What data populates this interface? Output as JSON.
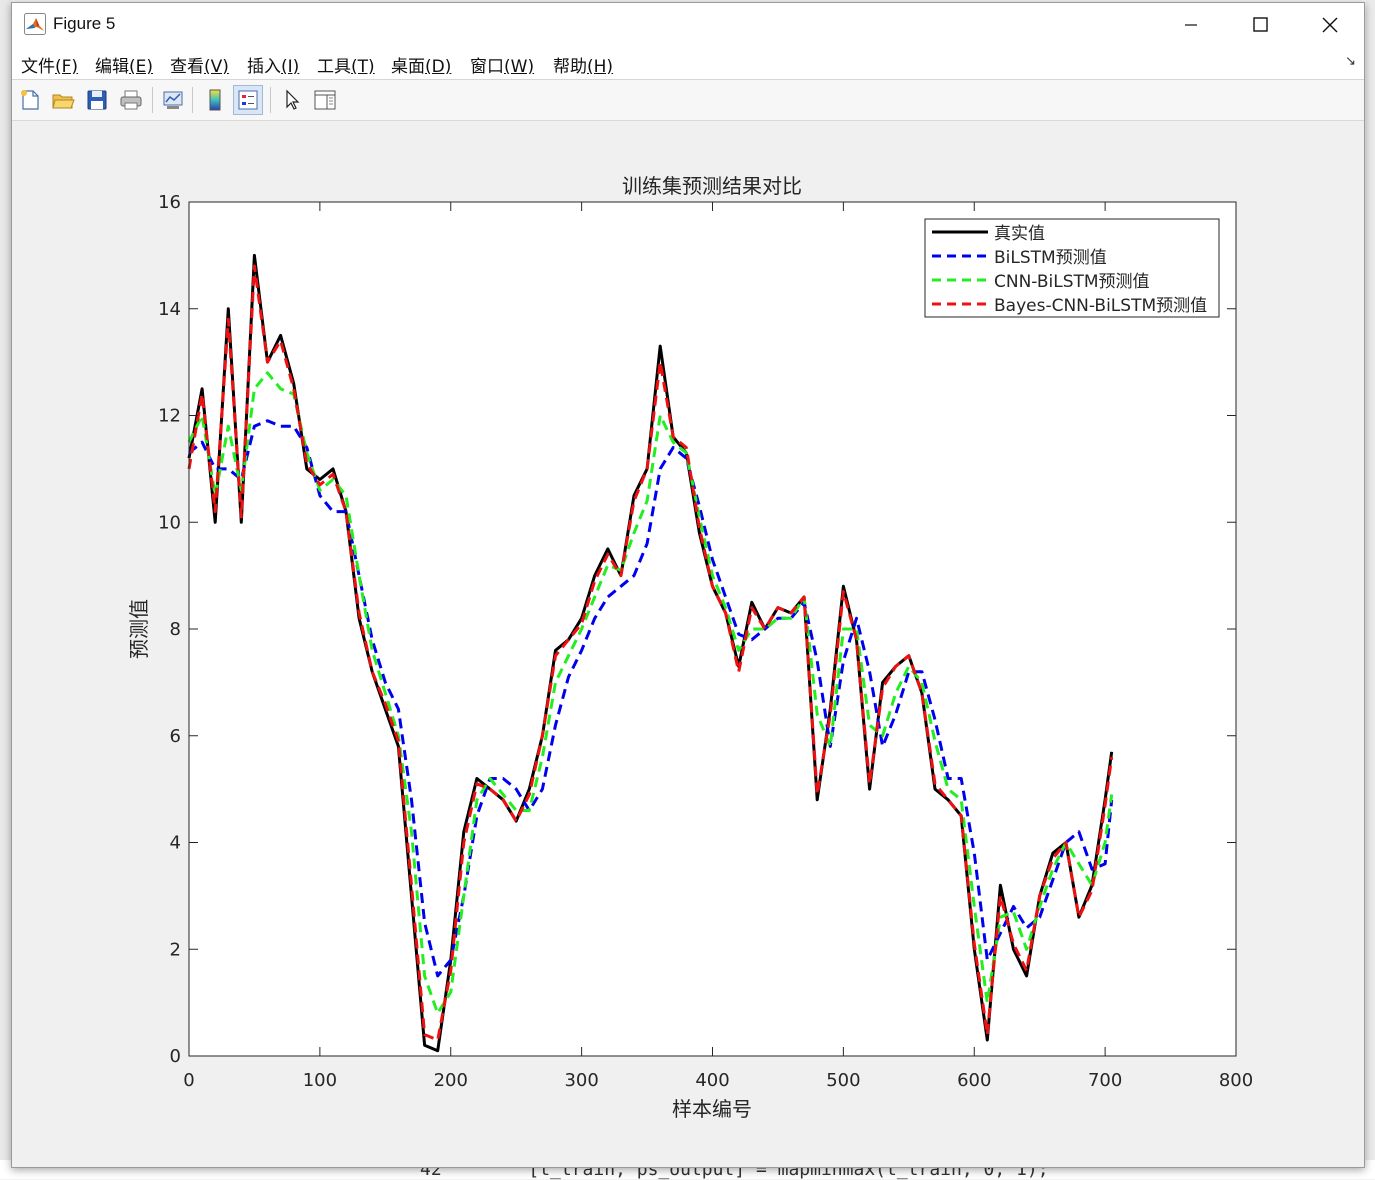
{
  "window": {
    "title": "Figure 5",
    "controls": [
      "minimize",
      "maximize",
      "close"
    ]
  },
  "menu": {
    "items": [
      {
        "label": "文件",
        "key": "(F)"
      },
      {
        "label": "编辑",
        "key": "(E)"
      },
      {
        "label": "查看",
        "key": "(V)"
      },
      {
        "label": "插入",
        "key": "(I)"
      },
      {
        "label": "工具",
        "key": "(T)"
      },
      {
        "label": "桌面",
        "key": "(D)"
      },
      {
        "label": "窗口",
        "key": "(W)"
      },
      {
        "label": "帮助",
        "key": "(H)"
      }
    ],
    "overflow_arrow": "↘"
  },
  "toolbar": {
    "icons": [
      "new-figure-icon",
      "open-file-icon",
      "save-icon",
      "print-icon",
      "link-plot-icon",
      "insert-colorbar-icon",
      "insert-legend-icon",
      "edit-plot-cursor-icon",
      "property-inspector-icon"
    ]
  },
  "background": {
    "code_text": "42        [t_train, ps_output] = mapminmax(t_train, 0, 1);"
  },
  "chart_data": {
    "type": "line",
    "title": "训练集预测结果对比",
    "xlabel": "样本编号",
    "ylabel": "预测值",
    "xlim": [
      0,
      800
    ],
    "ylim": [
      0,
      16
    ],
    "xticks": [
      0,
      100,
      200,
      300,
      400,
      500,
      600,
      700,
      800
    ],
    "yticks": [
      0,
      2,
      4,
      6,
      8,
      10,
      12,
      14,
      16
    ],
    "grid": false,
    "legend_position": "top-right",
    "x": [
      0,
      10,
      20,
      30,
      40,
      50,
      60,
      70,
      80,
      90,
      100,
      110,
      120,
      130,
      140,
      150,
      160,
      170,
      180,
      190,
      200,
      210,
      220,
      230,
      240,
      250,
      260,
      270,
      280,
      290,
      300,
      310,
      320,
      330,
      340,
      350,
      360,
      370,
      380,
      390,
      400,
      410,
      420,
      430,
      440,
      450,
      460,
      470,
      480,
      490,
      500,
      510,
      520,
      530,
      540,
      550,
      560,
      570,
      580,
      590,
      600,
      610,
      620,
      630,
      640,
      650,
      660,
      670,
      680,
      690,
      700,
      705
    ],
    "series": [
      {
        "name": "真实值",
        "color": "#000000",
        "style": "solid",
        "values": [
          11.2,
          12.5,
          10.0,
          14.0,
          10.0,
          15.0,
          13.0,
          13.5,
          12.6,
          11.0,
          10.8,
          11.0,
          10.2,
          8.2,
          7.2,
          6.5,
          5.8,
          3.0,
          0.2,
          0.1,
          1.8,
          4.2,
          5.2,
          5.0,
          4.8,
          4.4,
          5.0,
          6.0,
          7.6,
          7.8,
          8.2,
          9.0,
          9.5,
          9.0,
          10.5,
          11.0,
          13.3,
          11.6,
          11.3,
          9.8,
          8.8,
          8.3,
          7.3,
          8.5,
          8.0,
          8.4,
          8.3,
          8.6,
          4.8,
          6.5,
          8.8,
          7.8,
          5.0,
          7.0,
          7.3,
          7.5,
          6.8,
          5.0,
          4.8,
          4.5,
          2.0,
          0.3,
          3.2,
          2.0,
          1.5,
          3.0,
          3.8,
          4.0,
          2.6,
          3.2,
          4.8,
          5.7
        ]
      },
      {
        "name": "BiLSTM预测值",
        "color": "#0000ee",
        "style": "dashed",
        "values": [
          11.3,
          11.5,
          11.0,
          11.0,
          10.8,
          11.8,
          11.9,
          11.8,
          11.8,
          11.4,
          10.5,
          10.2,
          10.2,
          9.0,
          7.8,
          7.0,
          6.5,
          4.8,
          2.5,
          1.5,
          1.8,
          3.0,
          4.5,
          5.2,
          5.2,
          5.0,
          4.6,
          5.0,
          6.2,
          7.1,
          7.6,
          8.2,
          8.6,
          8.8,
          9.0,
          9.6,
          11.0,
          11.4,
          11.2,
          10.3,
          9.3,
          8.6,
          7.9,
          7.8,
          8.0,
          8.2,
          8.2,
          8.5,
          7.4,
          5.8,
          7.4,
          8.2,
          7.2,
          5.8,
          6.4,
          7.2,
          7.2,
          6.3,
          5.2,
          5.2,
          3.8,
          1.8,
          2.3,
          2.8,
          2.4,
          2.6,
          3.3,
          4.0,
          4.2,
          3.5,
          3.6,
          4.8
        ]
      },
      {
        "name": "CNN-BiLSTM预测值",
        "color": "#22ee22",
        "style": "dashed",
        "values": [
          11.5,
          12.0,
          10.5,
          11.8,
          10.6,
          12.5,
          12.8,
          12.5,
          12.4,
          11.3,
          10.6,
          10.8,
          10.5,
          9.0,
          7.6,
          6.8,
          6.0,
          4.2,
          1.5,
          0.8,
          1.2,
          3.0,
          4.8,
          5.2,
          4.9,
          4.6,
          4.6,
          5.6,
          7.0,
          7.5,
          8.0,
          8.6,
          9.2,
          9.1,
          9.8,
          10.4,
          12.0,
          11.5,
          11.3,
          10.1,
          9.0,
          8.4,
          7.6,
          8.0,
          8.0,
          8.2,
          8.2,
          8.6,
          6.4,
          5.8,
          8.0,
          8.0,
          6.2,
          6.0,
          6.8,
          7.3,
          7.0,
          5.9,
          5.0,
          4.8,
          2.8,
          1.0,
          2.6,
          2.7,
          2.0,
          2.8,
          3.5,
          4.0,
          3.6,
          3.2,
          4.0,
          4.9
        ]
      },
      {
        "name": "Bayes-CNN-BiLSTM预测值",
        "color": "#ee1111",
        "style": "dashed",
        "values": [
          11.0,
          12.4,
          10.2,
          13.8,
          10.1,
          14.8,
          13.0,
          13.4,
          12.5,
          11.1,
          10.7,
          10.9,
          10.2,
          8.3,
          7.2,
          6.6,
          5.9,
          3.2,
          0.4,
          0.3,
          1.6,
          4.0,
          5.1,
          5.0,
          4.8,
          4.4,
          4.9,
          6.0,
          7.5,
          7.8,
          8.1,
          8.9,
          9.4,
          9.0,
          10.4,
          11.0,
          13.0,
          11.6,
          11.4,
          9.9,
          8.8,
          8.3,
          7.2,
          8.4,
          8.0,
          8.4,
          8.3,
          8.6,
          4.9,
          6.4,
          8.7,
          7.8,
          5.1,
          6.9,
          7.3,
          7.5,
          6.8,
          5.1,
          4.8,
          4.5,
          2.1,
          0.4,
          3.0,
          2.1,
          1.6,
          3.0,
          3.7,
          4.0,
          2.6,
          3.1,
          4.7,
          5.6
        ]
      }
    ]
  }
}
